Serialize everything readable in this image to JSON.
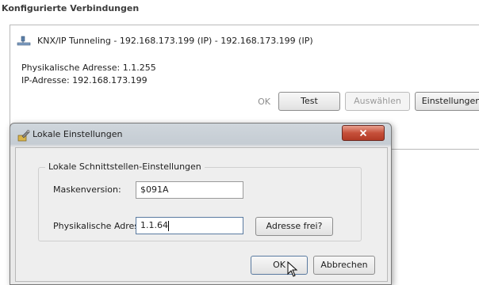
{
  "background": {
    "section_title": "Konfigurierte Verbindungen",
    "connection": {
      "name": "KNX/IP Tunneling - 192.168.173.199 (IP) - 192.168.173.199 (IP)",
      "physical_address": "Physikalische Adresse: 1.1.255",
      "ip_address": "IP-Adresse: 192.168.173.199",
      "icon": "network-icon"
    },
    "buttons": {
      "ok": "OK",
      "test": "Test",
      "select": "Auswählen",
      "settings": "Einstellungen"
    }
  },
  "dialog": {
    "title": "Lokale Einstellungen",
    "close_icon": "close-icon",
    "group_title": "Lokale Schnittstellen-Einstellungen",
    "mask_label": "Maskenversion:",
    "mask_value": "$091A",
    "phys_label": "Physikalische Adresse:",
    "phys_value": "1.1.64",
    "address_free_button": "Adresse frei?",
    "ok_button": "OK",
    "cancel_button": "Abbrechen"
  },
  "colors": {
    "close_button": "#c5503a",
    "dialog_frame": "#c5ccd3"
  }
}
